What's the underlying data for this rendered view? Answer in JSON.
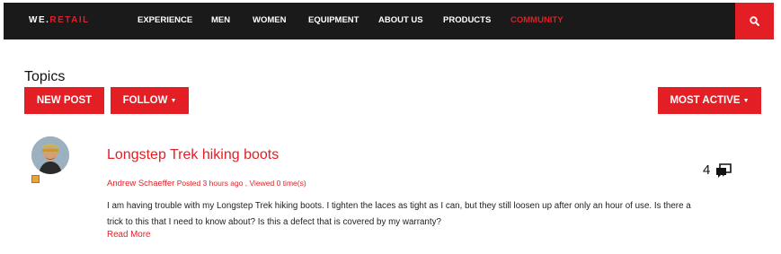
{
  "brand": {
    "prefix": "WE.",
    "suffix": "RETAIL"
  },
  "nav": {
    "items": [
      {
        "label": "EXPERIENCE"
      },
      {
        "label": "MEN"
      },
      {
        "label": "WOMEN"
      },
      {
        "label": "EQUIPMENT"
      },
      {
        "label": "ABOUT US"
      },
      {
        "label": "PRODUCTS"
      },
      {
        "label": "COMMUNITY",
        "active": true
      }
    ],
    "search_icon": "search-icon"
  },
  "page": {
    "title": "Topics",
    "new_post_label": "NEW POST",
    "follow_label": "FOLLOW",
    "sort_label": "MOST ACTIVE"
  },
  "post": {
    "title": "Longstep Trek hiking boots",
    "author": "Andrew Schaeffer",
    "meta": "Posted 3 hours ago , Viewed 0 time(s)",
    "body": "I am having trouble with my Longstep Trek hiking boots. I tighten the laces as tight as I can, but they still loosen up after only an hour of use. Is there a trick to this that I need to know about? Is this a defect that is covered by my warranty?",
    "read_more": "Read More",
    "reply_count": "4"
  },
  "colors": {
    "accent": "#e31e24",
    "navbar": "#1a1a1a"
  }
}
